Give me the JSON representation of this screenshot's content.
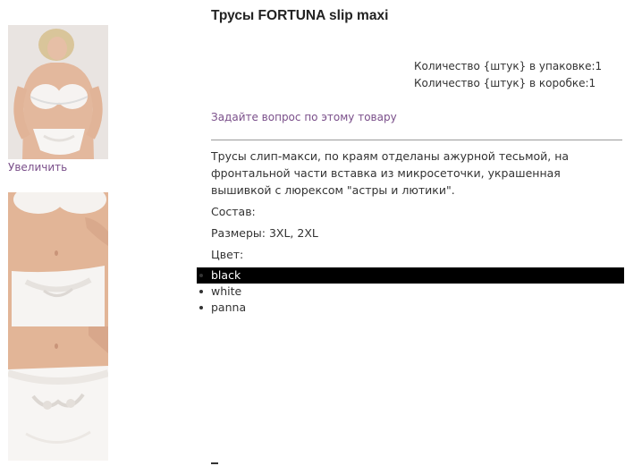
{
  "product": {
    "title": "Трусы FORTUNA slip maxi",
    "enlarge_link": "Увеличить",
    "qty_pack": "Количество {штук} в упаковке:1",
    "qty_box": "Количество {штук} в коробке:1",
    "ask_link": "Задайте вопрос по этому товару",
    "description": "Трусы слип-макси, по краям отделаны ажурной тесьмой, на фронтальной части вставка из микросеточки, украшенная вышивкой с люрексом \"астры и лютики\".",
    "composition_label": "Состав:",
    "sizes_line": "Размеры: 3XL, 2XL",
    "color_label": "Цвет:",
    "colors": [
      "black",
      "white",
      "panna"
    ]
  },
  "colors": {
    "link": "#7a4f8a",
    "selected_bg": "#000000",
    "selected_text": "#ffffff"
  }
}
